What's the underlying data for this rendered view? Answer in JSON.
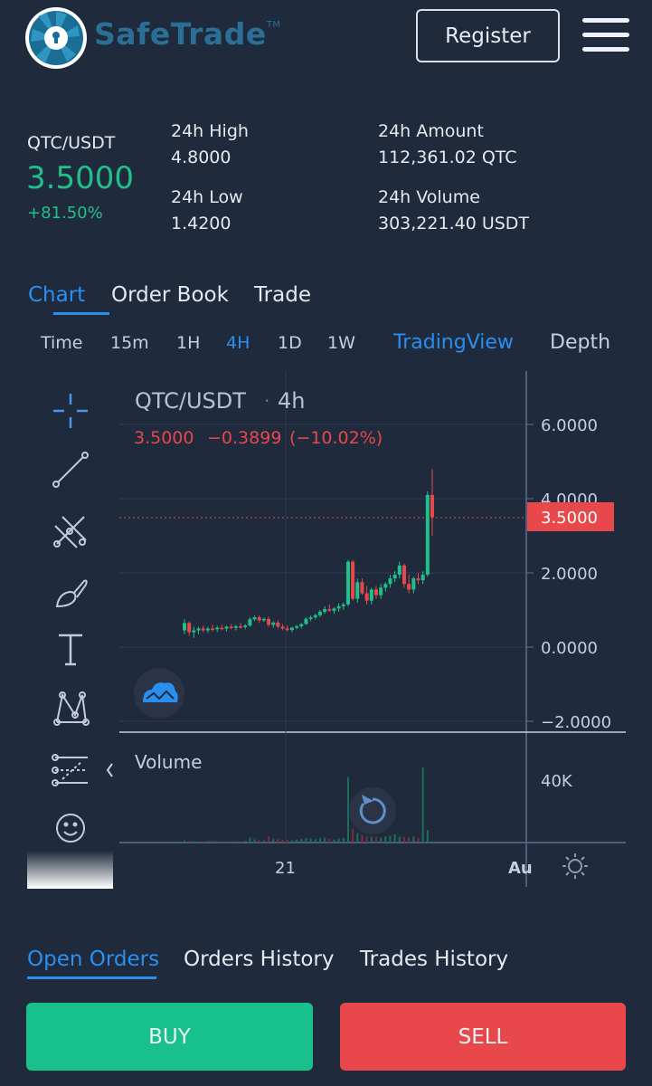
{
  "header": {
    "brand": "SafeTrade",
    "trademark": "TM",
    "register_label": "Register"
  },
  "market": {
    "pair": "QTC/USDT",
    "price": "3.5000",
    "change": "+81.50%",
    "high_label": "24h High",
    "high": "4.8000",
    "low_label": "24h Low",
    "low": "1.4200",
    "amount_label": "24h Amount",
    "amount": "112,361.02 QTC",
    "volume_label": "24h Volume",
    "volume": "303,221.40 USDT"
  },
  "tabs": [
    "Chart",
    "Order Book",
    "Trade"
  ],
  "intervals": [
    "Time",
    "15m",
    "1H",
    "4H",
    "1D",
    "1W"
  ],
  "active_interval": "4H",
  "chart_views": [
    "TradingView",
    "Depth"
  ],
  "chart_header": {
    "symbol": "QTC/USDT",
    "separator": "·",
    "interval": "4h",
    "last": "3.5000",
    "delta": "−0.3899",
    "delta_pct": "(−10.02%)",
    "volume_label": "Volume"
  },
  "chart_data": {
    "type": "candlestick",
    "title": "QTC/USDT · 4h",
    "y_ticks": [
      "6.0000",
      "4.0000",
      "2.0000",
      "0.0000",
      "−2.0000"
    ],
    "ylim": [
      -2,
      6
    ],
    "x_ticks": [
      "21",
      "Au"
    ],
    "last_price": "3.5000",
    "volume_tick": "40K",
    "candles": [
      {
        "o": 0.45,
        "h": 0.75,
        "l": 0.35,
        "c": 0.65
      },
      {
        "o": 0.65,
        "h": 0.7,
        "l": 0.3,
        "c": 0.4
      },
      {
        "o": 0.4,
        "h": 0.55,
        "l": 0.25,
        "c": 0.45
      },
      {
        "o": 0.45,
        "h": 0.55,
        "l": 0.35,
        "c": 0.5
      },
      {
        "o": 0.5,
        "h": 0.58,
        "l": 0.4,
        "c": 0.45
      },
      {
        "o": 0.45,
        "h": 0.55,
        "l": 0.38,
        "c": 0.5
      },
      {
        "o": 0.5,
        "h": 0.6,
        "l": 0.42,
        "c": 0.48
      },
      {
        "o": 0.48,
        "h": 0.58,
        "l": 0.4,
        "c": 0.52
      },
      {
        "o": 0.52,
        "h": 0.6,
        "l": 0.45,
        "c": 0.5
      },
      {
        "o": 0.5,
        "h": 0.58,
        "l": 0.42,
        "c": 0.55
      },
      {
        "o": 0.55,
        "h": 0.62,
        "l": 0.48,
        "c": 0.52
      },
      {
        "o": 0.52,
        "h": 0.6,
        "l": 0.45,
        "c": 0.56
      },
      {
        "o": 0.56,
        "h": 0.65,
        "l": 0.5,
        "c": 0.54
      },
      {
        "o": 0.54,
        "h": 0.62,
        "l": 0.48,
        "c": 0.58
      },
      {
        "o": 0.58,
        "h": 0.8,
        "l": 0.55,
        "c": 0.75
      },
      {
        "o": 0.75,
        "h": 0.85,
        "l": 0.7,
        "c": 0.8
      },
      {
        "o": 0.8,
        "h": 0.85,
        "l": 0.65,
        "c": 0.72
      },
      {
        "o": 0.72,
        "h": 0.8,
        "l": 0.68,
        "c": 0.76
      },
      {
        "o": 0.76,
        "h": 0.82,
        "l": 0.55,
        "c": 0.6
      },
      {
        "o": 0.6,
        "h": 0.7,
        "l": 0.52,
        "c": 0.66
      },
      {
        "o": 0.66,
        "h": 0.72,
        "l": 0.5,
        "c": 0.55
      },
      {
        "o": 0.55,
        "h": 0.62,
        "l": 0.45,
        "c": 0.5
      },
      {
        "o": 0.5,
        "h": 0.58,
        "l": 0.42,
        "c": 0.46
      },
      {
        "o": 0.46,
        "h": 0.55,
        "l": 0.4,
        "c": 0.52
      },
      {
        "o": 0.52,
        "h": 0.6,
        "l": 0.48,
        "c": 0.56
      },
      {
        "o": 0.56,
        "h": 0.65,
        "l": 0.5,
        "c": 0.62
      },
      {
        "o": 0.62,
        "h": 0.8,
        "l": 0.6,
        "c": 0.76
      },
      {
        "o": 0.76,
        "h": 0.85,
        "l": 0.7,
        "c": 0.8
      },
      {
        "o": 0.8,
        "h": 0.9,
        "l": 0.75,
        "c": 0.86
      },
      {
        "o": 0.86,
        "h": 1.0,
        "l": 0.8,
        "c": 0.95
      },
      {
        "o": 0.95,
        "h": 1.1,
        "l": 0.9,
        "c": 1.02
      },
      {
        "o": 1.02,
        "h": 1.15,
        "l": 0.95,
        "c": 0.98
      },
      {
        "o": 0.98,
        "h": 1.08,
        "l": 0.9,
        "c": 1.04
      },
      {
        "o": 1.04,
        "h": 1.18,
        "l": 0.95,
        "c": 1.1
      },
      {
        "o": 1.1,
        "h": 1.2,
        "l": 1.0,
        "c": 1.15
      },
      {
        "o": 1.15,
        "h": 2.35,
        "l": 1.1,
        "c": 2.3
      },
      {
        "o": 2.3,
        "h": 2.35,
        "l": 1.25,
        "c": 1.3
      },
      {
        "o": 1.3,
        "h": 1.85,
        "l": 1.2,
        "c": 1.75
      },
      {
        "o": 1.75,
        "h": 1.85,
        "l": 1.4,
        "c": 1.45
      },
      {
        "o": 1.45,
        "h": 1.65,
        "l": 1.15,
        "c": 1.25
      },
      {
        "o": 1.25,
        "h": 1.6,
        "l": 1.15,
        "c": 1.55
      },
      {
        "o": 1.55,
        "h": 1.65,
        "l": 1.3,
        "c": 1.4
      },
      {
        "o": 1.4,
        "h": 1.7,
        "l": 1.3,
        "c": 1.6
      },
      {
        "o": 1.6,
        "h": 1.75,
        "l": 1.5,
        "c": 1.7
      },
      {
        "o": 1.7,
        "h": 1.95,
        "l": 1.6,
        "c": 1.85
      },
      {
        "o": 1.85,
        "h": 2.05,
        "l": 1.75,
        "c": 1.95
      },
      {
        "o": 1.95,
        "h": 2.3,
        "l": 1.85,
        "c": 2.2
      },
      {
        "o": 2.2,
        "h": 2.25,
        "l": 1.6,
        "c": 1.7
      },
      {
        "o": 1.7,
        "h": 1.95,
        "l": 1.45,
        "c": 1.55
      },
      {
        "o": 1.55,
        "h": 1.9,
        "l": 1.45,
        "c": 1.85
      },
      {
        "o": 1.85,
        "h": 2.0,
        "l": 1.7,
        "c": 1.8
      },
      {
        "o": 1.8,
        "h": 2.05,
        "l": 1.7,
        "c": 1.95
      },
      {
        "o": 1.95,
        "h": 4.2,
        "l": 1.9,
        "c": 4.1
      },
      {
        "o": 4.1,
        "h": 4.8,
        "l": 3.0,
        "c": 3.5
      }
    ],
    "volumes": [
      1400,
      1000,
      800,
      600,
      700,
      900,
      1200,
      800,
      700,
      600,
      1100,
      900,
      800,
      1000,
      3200,
      2000,
      1500,
      1300,
      4000,
      2500,
      2200,
      1800,
      1600,
      1400,
      2000,
      2400,
      3000,
      2600,
      2200,
      2800,
      3000,
      2400,
      2000,
      2600,
      3000,
      42000,
      9000,
      6000,
      5000,
      4200,
      3800,
      3600,
      3200,
      4000,
      4400,
      5200,
      3800,
      3600,
      3400,
      3900,
      3200,
      48000,
      8000
    ]
  },
  "bottom_tabs": [
    "Open Orders",
    "Orders History",
    "Trades History"
  ],
  "actions": {
    "buy": "BUY",
    "sell": "SELL"
  },
  "colors": {
    "background": "#1f2a3c",
    "accent": "#2a8ff0",
    "up": "#20c08b",
    "down": "#e8474b",
    "buy": "#18c08b",
    "sell": "#e8474b"
  },
  "icons": [
    "logo-lock-icon",
    "menu-icon",
    "crosshair-icon",
    "trend-line-icon",
    "pitchfork-icon",
    "brush-icon",
    "text-icon",
    "pattern-icon",
    "measure-icon",
    "emoji-icon",
    "tradingview-logo-icon",
    "reset-chart-icon",
    "settings-gear-icon",
    "collapse-chevron-icon"
  ]
}
